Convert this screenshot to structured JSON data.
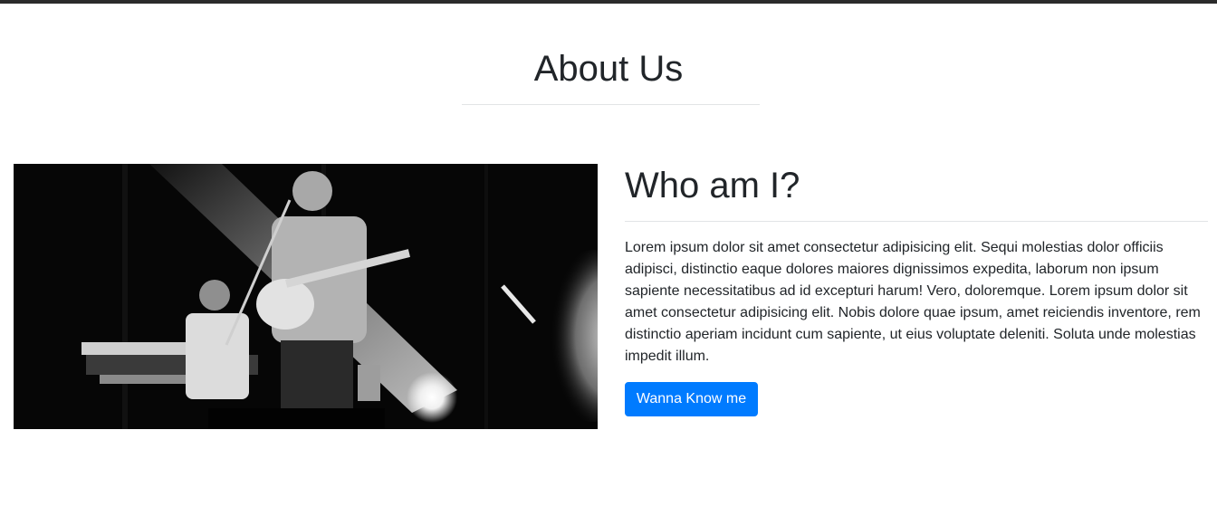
{
  "header": {
    "title": "About Us"
  },
  "about": {
    "photo_alt": "Black and white photo of a band performing on stage: a guitarist singing at a microphone and a keyboard player behind him",
    "heading": "Who am I?",
    "paragraph": "Lorem ipsum dolor sit amet consectetur adipisicing elit. Sequi molestias dolor officiis adipisci, distinctio eaque dolores maiores dignissimos expedita, laborum non ipsum sapiente necessitatibus ad id excepturi harum! Vero, doloremque. Lorem ipsum dolor sit amet consectetur adipisicing elit. Nobis dolore quae ipsum, amet reiciendis inventore, rem distinctio aperiam incidunt cum sapiente, ut eius voluptate deleniti. Soluta unde molestias impedit illum.",
    "button_label": "Wanna Know me"
  },
  "colors": {
    "accent": "#007bff",
    "top_bar": "#2b2b2b",
    "text": "#212529",
    "divider": "#e2e4e6"
  }
}
